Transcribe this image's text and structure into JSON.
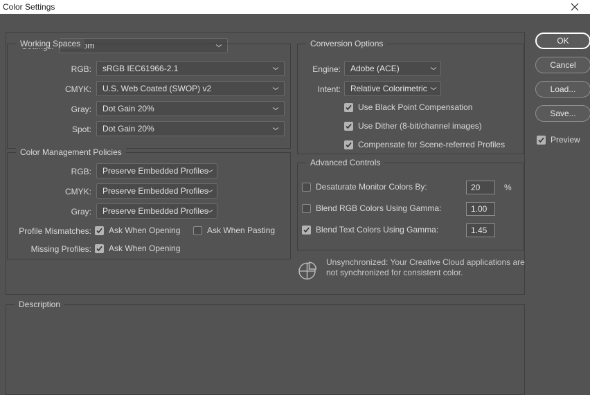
{
  "window": {
    "title": "Color Settings",
    "close_icon": "close-icon"
  },
  "settings_row": {
    "label": "Settings:",
    "value": "Custom"
  },
  "working_spaces": {
    "title": "Working Spaces",
    "rows": [
      {
        "label": "RGB:",
        "value": "sRGB IEC61966-2.1"
      },
      {
        "label": "CMYK:",
        "value": "U.S. Web Coated (SWOP) v2"
      },
      {
        "label": "Gray:",
        "value": "Dot Gain 20%"
      },
      {
        "label": "Spot:",
        "value": "Dot Gain 20%"
      }
    ]
  },
  "policies": {
    "title": "Color Management Policies",
    "rows": [
      {
        "label": "RGB:",
        "value": "Preserve Embedded Profiles"
      },
      {
        "label": "CMYK:",
        "value": "Preserve Embedded Profiles"
      },
      {
        "label": "Gray:",
        "value": "Preserve Embedded Profiles"
      }
    ],
    "profile_mismatches_label": "Profile Mismatches:",
    "ask_when_opening_mismatch": {
      "label": "Ask When Opening",
      "checked": true
    },
    "ask_when_pasting": {
      "label": "Ask When Pasting",
      "checked": false
    },
    "missing_profiles_label": "Missing Profiles:",
    "ask_when_opening_missing": {
      "label": "Ask When Opening",
      "checked": true
    }
  },
  "conversion": {
    "title": "Conversion Options",
    "engine_label": "Engine:",
    "engine_value": "Adobe (ACE)",
    "intent_label": "Intent:",
    "intent_value": "Relative Colorimetric",
    "checks": [
      {
        "label": "Use Black Point Compensation",
        "checked": true
      },
      {
        "label": "Use Dither (8-bit/channel images)",
        "checked": true
      },
      {
        "label": "Compensate for Scene-referred Profiles",
        "checked": true
      }
    ]
  },
  "advanced": {
    "title": "Advanced Controls",
    "rows": [
      {
        "label": "Desaturate Monitor Colors By:",
        "checked": false,
        "value": "20",
        "unit": "%"
      },
      {
        "label": "Blend RGB Colors Using Gamma:",
        "checked": false,
        "value": "1.00",
        "unit": ""
      },
      {
        "label": "Blend Text Colors Using Gamma:",
        "checked": true,
        "value": "1.45",
        "unit": ""
      }
    ]
  },
  "sync_note": {
    "icon": "color-sync-icon",
    "text": "Unsynchronized: Your Creative Cloud applications are not synchronized for consistent color."
  },
  "description": {
    "title": "Description",
    "text": ""
  },
  "buttons": {
    "ok": "OK",
    "cancel": "Cancel",
    "load": "Load...",
    "save": "Save...",
    "preview": {
      "label": "Preview",
      "checked": true
    }
  },
  "colors": {
    "dialog_bg": "#535353",
    "field_bg": "#4a4a4a",
    "field_border": "#8c8c8c",
    "group_border": "#3e3e3e",
    "text": "#d9d9d9",
    "titlebar_bg": "#ffffff"
  }
}
